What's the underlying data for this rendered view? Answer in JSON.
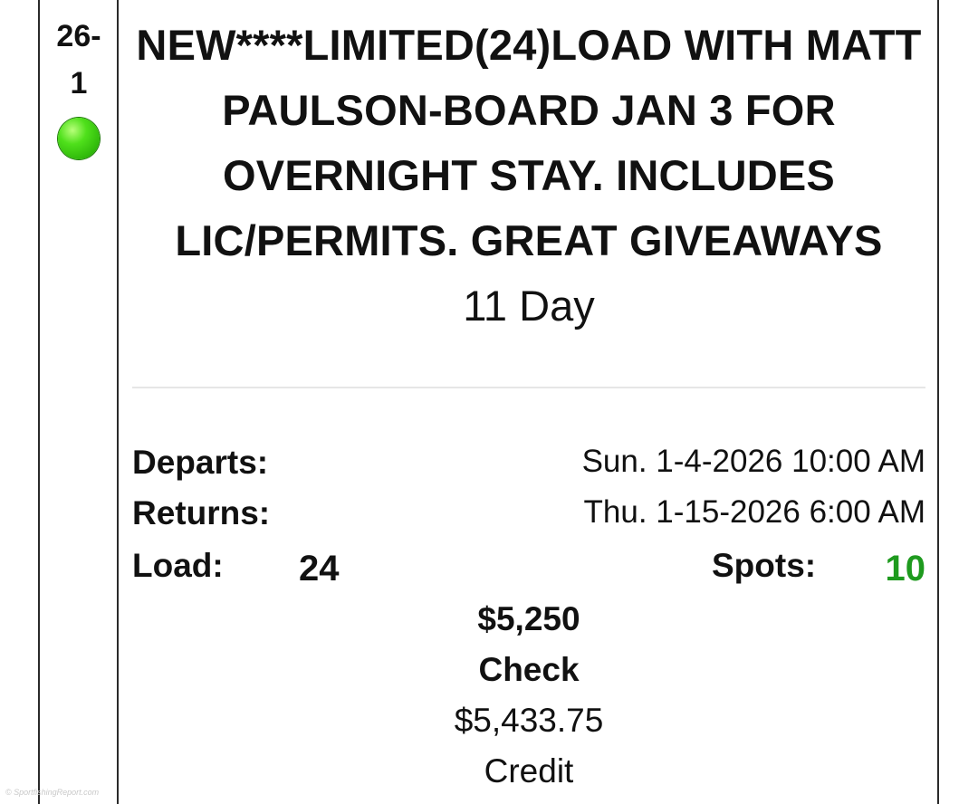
{
  "trip": {
    "id": "26-\n1",
    "status_color": "#3fcf12",
    "title": "NEW****LIMITED(24)LOAD WITH MATT PAULSON-BOARD JAN 3 FOR OVERNIGHT STAY. INCLUDES LIC/PERMITS. GREAT GIVEAWAYS",
    "duration": "11 Day"
  },
  "details": {
    "departs_label": "Departs:",
    "departs_value": "Sun. 1-4-2026 10:00 AM",
    "returns_label": "Returns:",
    "returns_value": "Thu. 1-15-2026 6:00 AM",
    "load_label": "Load:",
    "load_value": "24",
    "spots_label": "Spots:",
    "spots_value": "10",
    "spots_color": "#1e9a1e"
  },
  "pricing": {
    "check_price": "$5,250",
    "check_label": "Check",
    "credit_price": "$5,433.75",
    "credit_label": "Credit"
  },
  "watermark": "© SportfishingReport.com"
}
